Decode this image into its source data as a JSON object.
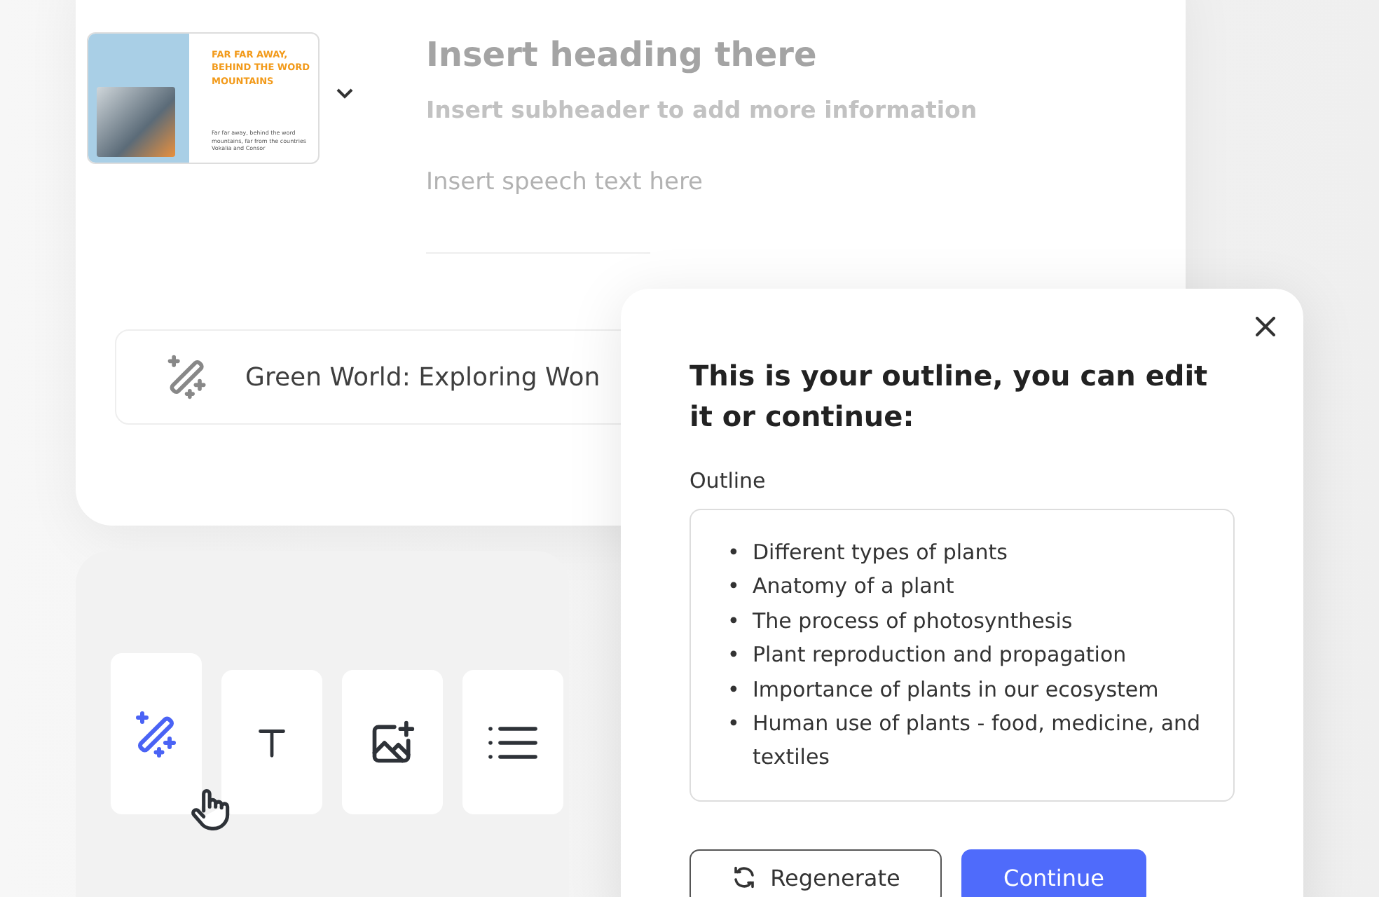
{
  "editor_card": {
    "thumbnail": {
      "title": "FAR FAR AWAY, BEHIND THE WORD MOUNTAINS",
      "body": "Far far away, behind the word mountains, far from the countries Vokalia and Consor"
    },
    "heading": {
      "placeholder": "Insert heading there"
    },
    "subheader": {
      "placeholder": "Insert subheader to add more information"
    },
    "speech": {
      "placeholder": "Insert speech text here"
    },
    "prompt": {
      "value": "Green World: Exploring Won"
    }
  },
  "tools": [
    {
      "kind": "magic",
      "selected": true
    },
    {
      "kind": "text",
      "selected": false
    },
    {
      "kind": "image",
      "selected": false
    },
    {
      "kind": "list",
      "selected": false
    }
  ],
  "dialog": {
    "title": "This is your outline, you can edit it or continue:",
    "field_label": "Outline",
    "outline": [
      {
        "marker": "•",
        "text": "Different types of plants"
      },
      {
        "marker": "•",
        "text": "Anatomy of a plant"
      },
      {
        "marker": "•",
        "text": "The process of photosynthesis"
      },
      {
        "marker": "•",
        "text": "Plant reproduction and propagation"
      },
      {
        "marker": "•",
        "text": "Importance of plants in our ecosystem"
      },
      {
        "marker": "•",
        "text": "Human use of plants - food, medicine, and textiles"
      }
    ],
    "buttons": [
      {
        "kind": "secondary",
        "label": "Regenerate"
      },
      {
        "kind": "primary",
        "label": "Continue"
      }
    ]
  }
}
